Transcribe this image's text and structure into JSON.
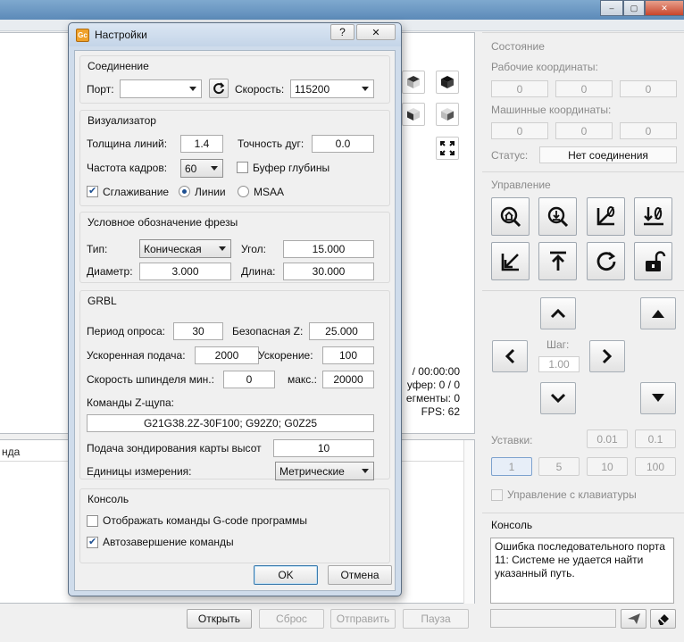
{
  "main": {
    "info_lines": [
      "/ 00:00:00",
      "уфер: 0 / 0",
      "егменты: 0",
      "FPS: 62"
    ],
    "lower_header": "нда",
    "bottom_buttons": {
      "open": "Открыть",
      "reset": "Сброс",
      "send": "Отправить",
      "pause": "Пауза"
    }
  },
  "state": {
    "title": "Состояние",
    "work_label": "Рабочие координаты:",
    "work": [
      "0",
      "0",
      "0"
    ],
    "machine_label": "Машинные координаты:",
    "machine": [
      "0",
      "0",
      "0"
    ],
    "status_label": "Статус:",
    "status_value": "Нет соединения"
  },
  "control": {
    "title": "Управление"
  },
  "jog": {
    "step_label": "Шаг:",
    "step_value": "1.00",
    "presets_label": "Уставки:",
    "presets_top": [
      "0.01",
      "0.1"
    ],
    "presets_bottom": [
      "1",
      "5",
      "10",
      "100"
    ],
    "keyboard_label": "Управление с клавиатуры"
  },
  "console": {
    "title": "Консоль",
    "lines": [
      "Ошибка последовательного порта",
      "11: Системе не удается найти",
      "указанный путь."
    ]
  },
  "dialog": {
    "title": "Настройки",
    "help_btn": "?",
    "close_btn": "✕",
    "connection": {
      "title": "Соединение",
      "port_label": "Порт:",
      "port_value": "",
      "speed_label": "Скорость:",
      "speed_value": "115200"
    },
    "visualizer": {
      "title": "Визуализатор",
      "line_width_label": "Толщина линий:",
      "line_width": "1.4",
      "arc_label": "Точность дуг:",
      "arc": "0.0",
      "fps_label": "Частота кадров:",
      "fps": "60",
      "depth_label": "Буфер глубины",
      "depth_checked": false,
      "smooth_label": "Сглаживание",
      "smooth_checked": true,
      "lines_label": "Линии",
      "lines_selected": true,
      "msaa_label": "MSAA",
      "msaa_selected": false
    },
    "tool": {
      "title": "Условное обозначение фрезы",
      "type_label": "Тип:",
      "type_value": "Коническая",
      "angle_label": "Угол:",
      "angle": "15.000",
      "diameter_label": "Диаметр:",
      "diameter": "3.000",
      "length_label": "Длина:",
      "length": "30.000"
    },
    "grbl": {
      "title": "GRBL",
      "poll_label": "Период опроса:",
      "poll": "30",
      "safez_label": "Безопасная Z:",
      "safez": "25.000",
      "rapid_label": "Ускоренная подача:",
      "rapid": "2000",
      "accel_label": "Ускорение:",
      "accel": "100",
      "spindle_min_label": "Скорость шпинделя мин.:",
      "spindle_min": "0",
      "spindle_max_label": "макс.:",
      "spindle_max": "20000",
      "probe_label": "Команды Z-щупа:",
      "probe": "G21G38.2Z-30F100; G92Z0; G0Z25",
      "heightmap_label": "Подача зондирования карты высот",
      "heightmap": "10",
      "units_label": "Единицы измерения:",
      "units_value": "Метрические"
    },
    "console": {
      "title": "Консоль",
      "show_gcode_label": "Отображать команды G-code программы",
      "show_gcode_checked": false,
      "autocomplete_label": "Автозавершение команды",
      "autocomplete_checked": true
    },
    "ok": "OK",
    "cancel": "Отмена"
  },
  "colors": {
    "accent": "#3d7bad",
    "titlebar": "#c4d5e8"
  }
}
